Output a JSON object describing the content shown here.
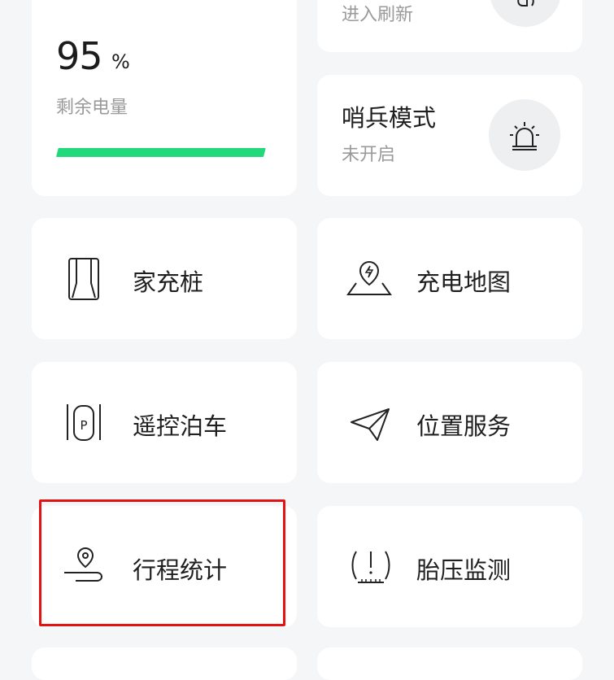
{
  "battery": {
    "value": "95",
    "unit": "%",
    "label": "剩余电量",
    "level_percent": 95,
    "bar_color": "#21d97a"
  },
  "top_right_card": {
    "subtitle": "进入刷新",
    "icon": "refresh-icon"
  },
  "sentry": {
    "title": "哨兵模式",
    "status": "未开启",
    "icon": "siren-icon"
  },
  "tiles": [
    {
      "label": "家充桩",
      "icon": "home-charger-icon"
    },
    {
      "label": "充电地图",
      "icon": "charging-map-icon"
    },
    {
      "label": "遥控泊车",
      "icon": "remote-parking-icon"
    },
    {
      "label": "位置服务",
      "icon": "send-location-icon"
    },
    {
      "label": "行程统计",
      "icon": "trip-route-icon"
    },
    {
      "label": "胎压监测",
      "icon": "tire-pressure-icon"
    }
  ],
  "colors": {
    "background": "#f5f6f8",
    "card": "#ffffff",
    "highlight": "#e31313"
  }
}
